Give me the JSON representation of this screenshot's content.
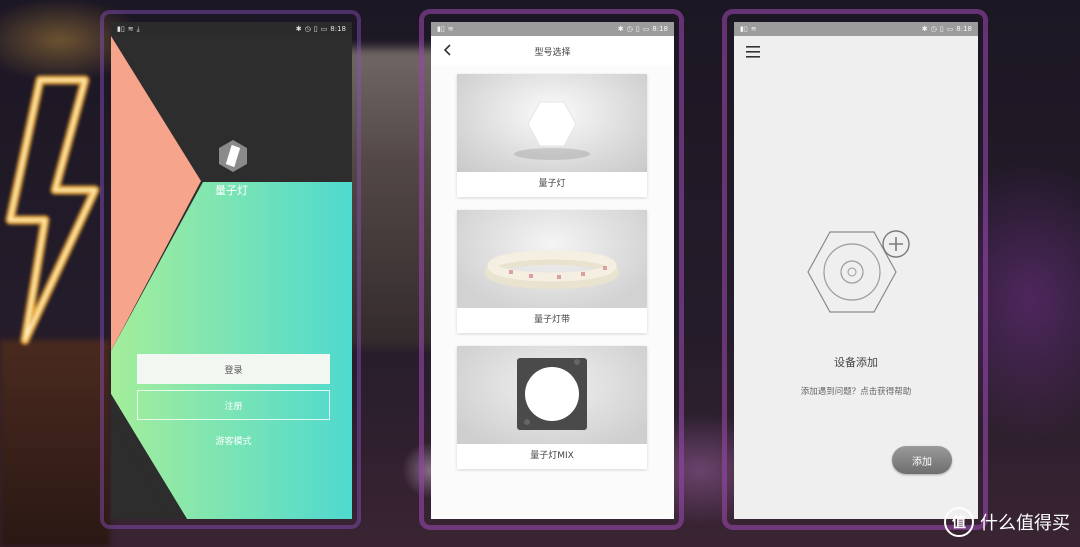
{
  "status_bar": {
    "time": "8:18",
    "left_icons": [
      "sim-signal-icon",
      "wifi-icon",
      "download-icon"
    ],
    "right_icons": [
      "bluetooth-icon",
      "alarm-icon",
      "vibrate-icon",
      "battery-icon"
    ]
  },
  "login_screen": {
    "brand_name": "量子灯",
    "login_label": "登录",
    "register_label": "注册",
    "guest_label": "游客模式",
    "colors": {
      "salmon": "#f5a48d",
      "mint": "#5fe0c8",
      "dark": "#2d2d2d"
    }
  },
  "model_select": {
    "title": "型号选择",
    "items": [
      {
        "label": "量子灯",
        "image": "hexagon-panel-photo"
      },
      {
        "label": "量子灯带",
        "image": "led-strip-photo"
      },
      {
        "label": "量子灯MIX",
        "image": "square-round-panel-photo"
      }
    ]
  },
  "device_add": {
    "title": "设备添加",
    "help_text": "添加遇到问题？点击获得帮助",
    "add_label": "添加"
  },
  "watermark": {
    "text": "什么值得买",
    "badge": "值"
  }
}
